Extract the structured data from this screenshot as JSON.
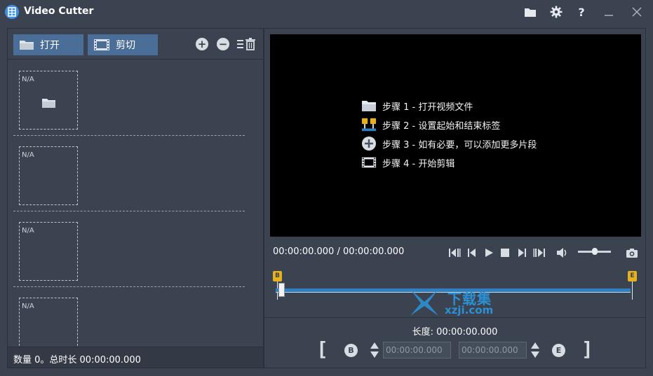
{
  "app": {
    "title": "Video Cutter"
  },
  "left_toolbar": {
    "open_label": "打开",
    "cut_label": "剪切"
  },
  "clips": [
    {
      "thumb_label": "N/A"
    },
    {
      "thumb_label": "N/A"
    },
    {
      "thumb_label": "N/A"
    },
    {
      "thumb_label": "N/A"
    }
  ],
  "status": {
    "text": "数量 0。总时长 00:00:00.000"
  },
  "preview": {
    "steps": [
      {
        "icon": "folder-icon",
        "text": "步骤 1 - 打开视频文件"
      },
      {
        "icon": "markers-icon",
        "text": "步骤 2 - 设置起始和结束标签"
      },
      {
        "icon": "add-circle-icon",
        "text": "步骤 3 - 如有必要，可以添加更多片段"
      },
      {
        "icon": "film-icon",
        "text": "步骤 4 - 开始剪辑"
      }
    ]
  },
  "player": {
    "time": "00:00:00.000 / 00:00:00.000",
    "volume_level": 0.5
  },
  "timeline": {
    "start_marker": "B",
    "end_marker": "E"
  },
  "segment": {
    "duration_text": "长度: 00:00:00.000",
    "begin_button": "B",
    "end_button": "E",
    "begin_placeholder": "00:00:00.000",
    "end_placeholder": "00:00:00.000",
    "left_bracket": "[",
    "right_bracket": "]"
  },
  "watermark": {
    "main": "下载集",
    "sub": "xzji.com"
  },
  "colors": {
    "accent": "#4a6e98",
    "timeline": "#2f7fc3",
    "marker": "#e7b11e",
    "background": "#3b4350"
  }
}
